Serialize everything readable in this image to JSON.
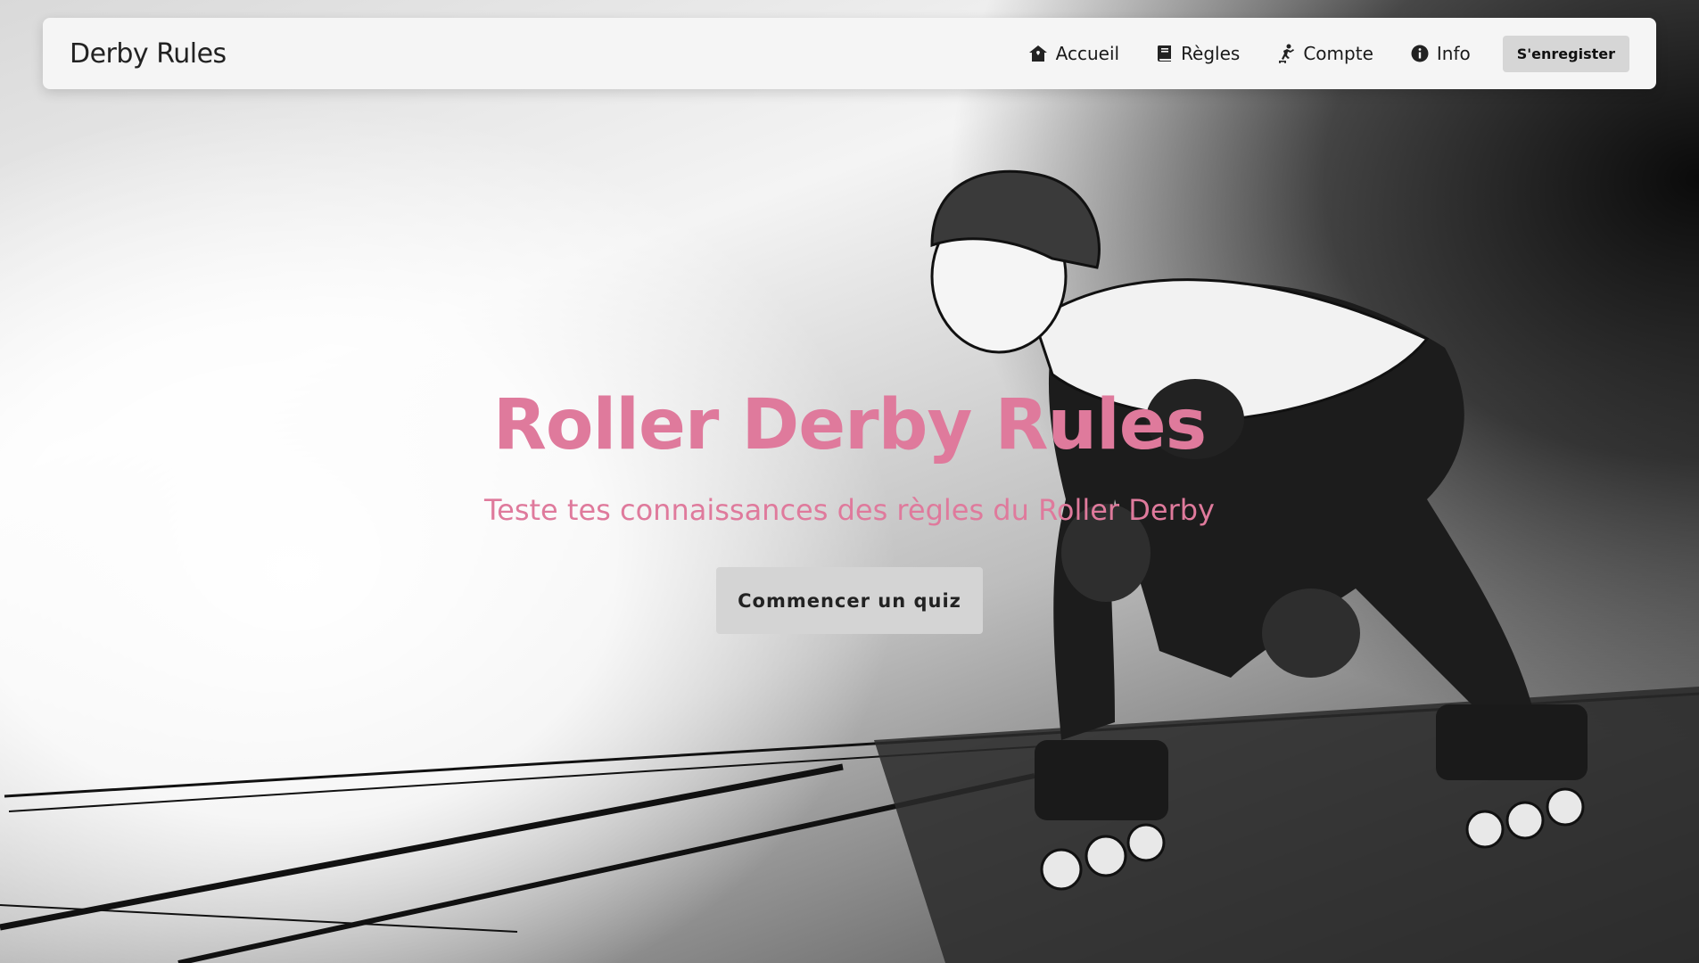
{
  "navbar": {
    "brand": "Derby Rules",
    "items": [
      {
        "label": "Accueil",
        "icon": "home-icon"
      },
      {
        "label": "Règles",
        "icon": "book-icon"
      },
      {
        "label": "Compte",
        "icon": "skater-icon"
      },
      {
        "label": "Info",
        "icon": "info-icon"
      }
    ],
    "cta_label": "S'enregister"
  },
  "hero": {
    "title": "Roller Derby Rules",
    "subtitle": "Teste tes connaissances des règles du Roller Derby",
    "button_label": "Commencer un quiz",
    "background": "roller-derby-skater-illustration"
  },
  "colors": {
    "accent_pink": "#df7a9c",
    "navbar_bg": "#f5f5f5",
    "button_bg": "#d4d4d4"
  }
}
